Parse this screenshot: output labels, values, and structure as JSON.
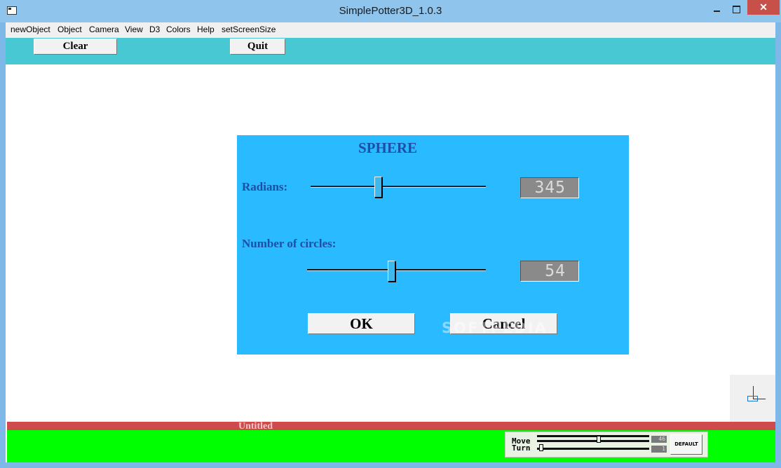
{
  "window": {
    "title": "SimplePotter3D_1.0.3",
    "close_glyph": "✕"
  },
  "menu": {
    "items": [
      "newObject",
      "Object",
      "Camera",
      "View",
      "D3",
      "Colors",
      "Help",
      "setScreenSize"
    ]
  },
  "toolbar": {
    "clear_label": "Clear",
    "quit_label": "Quit"
  },
  "dialog": {
    "title": "SPHERE",
    "radians_label": "Radians:",
    "radians_value": "345",
    "radians_fraction": 0.38,
    "circles_label": "Number of circles:",
    "circles_value": "54",
    "circles_fraction": 0.47,
    "ok_label": "OK",
    "cancel_label": "Cancel",
    "watermark": "SOFTPEDIA"
  },
  "status": {
    "document_name": "Untitled"
  },
  "navigation_panel": {
    "move_label": "Move",
    "move_value": "46",
    "move_fraction": 0.55,
    "turn_label": "Turn",
    "turn_value": "1",
    "turn_fraction": 0.02,
    "default_label": "DEFAULT"
  },
  "colors": {
    "toolbar_bg": "#48c8d3",
    "dialog_bg": "#29baff",
    "status_bar": "#cf4a4a",
    "bottom_panel": "#00ff00",
    "dialog_text": "#1d4fa6"
  },
  "icons": {
    "app": "window-app-icon",
    "axis": "axis-gizmo-icon"
  }
}
